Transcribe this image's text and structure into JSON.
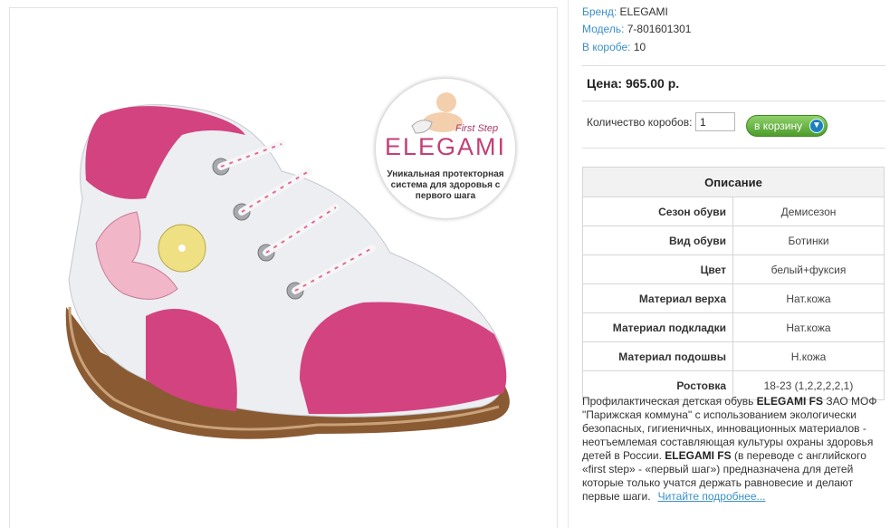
{
  "product": {
    "brand_label": "Бренд:",
    "brand": "ELEGAMI",
    "model_label": "Модель:",
    "model": "7-801601301",
    "box_label": "В коробе:",
    "box_count": "10",
    "price": "Цена: 965.00 р.",
    "qty_label": "Количество коробов:",
    "qty_value": "1",
    "cart_label": "в корзину"
  },
  "image": {
    "badge_brand": "ELEGAMI",
    "badge_first_step": "First Step",
    "badge_text_1": "Уникальная протекторная",
    "badge_text_2": "система для здоровья с",
    "badge_text_3": "первого шага"
  },
  "specs": {
    "title": "Описание",
    "rows": [
      {
        "label": "Сезон обуви",
        "value": "Демисезон"
      },
      {
        "label": "Вид обуви",
        "value": "Ботинки"
      },
      {
        "label": "Цвет",
        "value": "белый+фуксия"
      },
      {
        "label": "Материал верха",
        "value": "Нат.кожа"
      },
      {
        "label": "Материал подкладки",
        "value": "Нат.кожа"
      },
      {
        "label": "Материал подошвы",
        "value": "Н.кожа"
      },
      {
        "label": "Ростовка",
        "value": "18-23 (1,2,2,2,2,1)"
      }
    ]
  },
  "description": {
    "t1": "Профилактическая детская обувь ",
    "b1": "ELEGAMI FS",
    "t2": " ЗАО МОФ \"Парижская коммуна\" с использованием экологически безопасных, гигиеничных, инновационных материалов - неотъемлемая составляющая культуры охраны здоровья детей в России. ",
    "b2": "ELEGAMI FS",
    "t3": " (в переводе с английского «first step» - «первый шаг») предназначена для детей которые только учатся держать равновесие и делают первые шаги.",
    "more_link": "Читайте подробнее..."
  },
  "colors": {
    "link": "#3a8fc8",
    "cart_button": "#5aab35",
    "shoe_pink": "#d2437f",
    "shoe_white": "#eceef2",
    "sole": "#8a5a33"
  }
}
